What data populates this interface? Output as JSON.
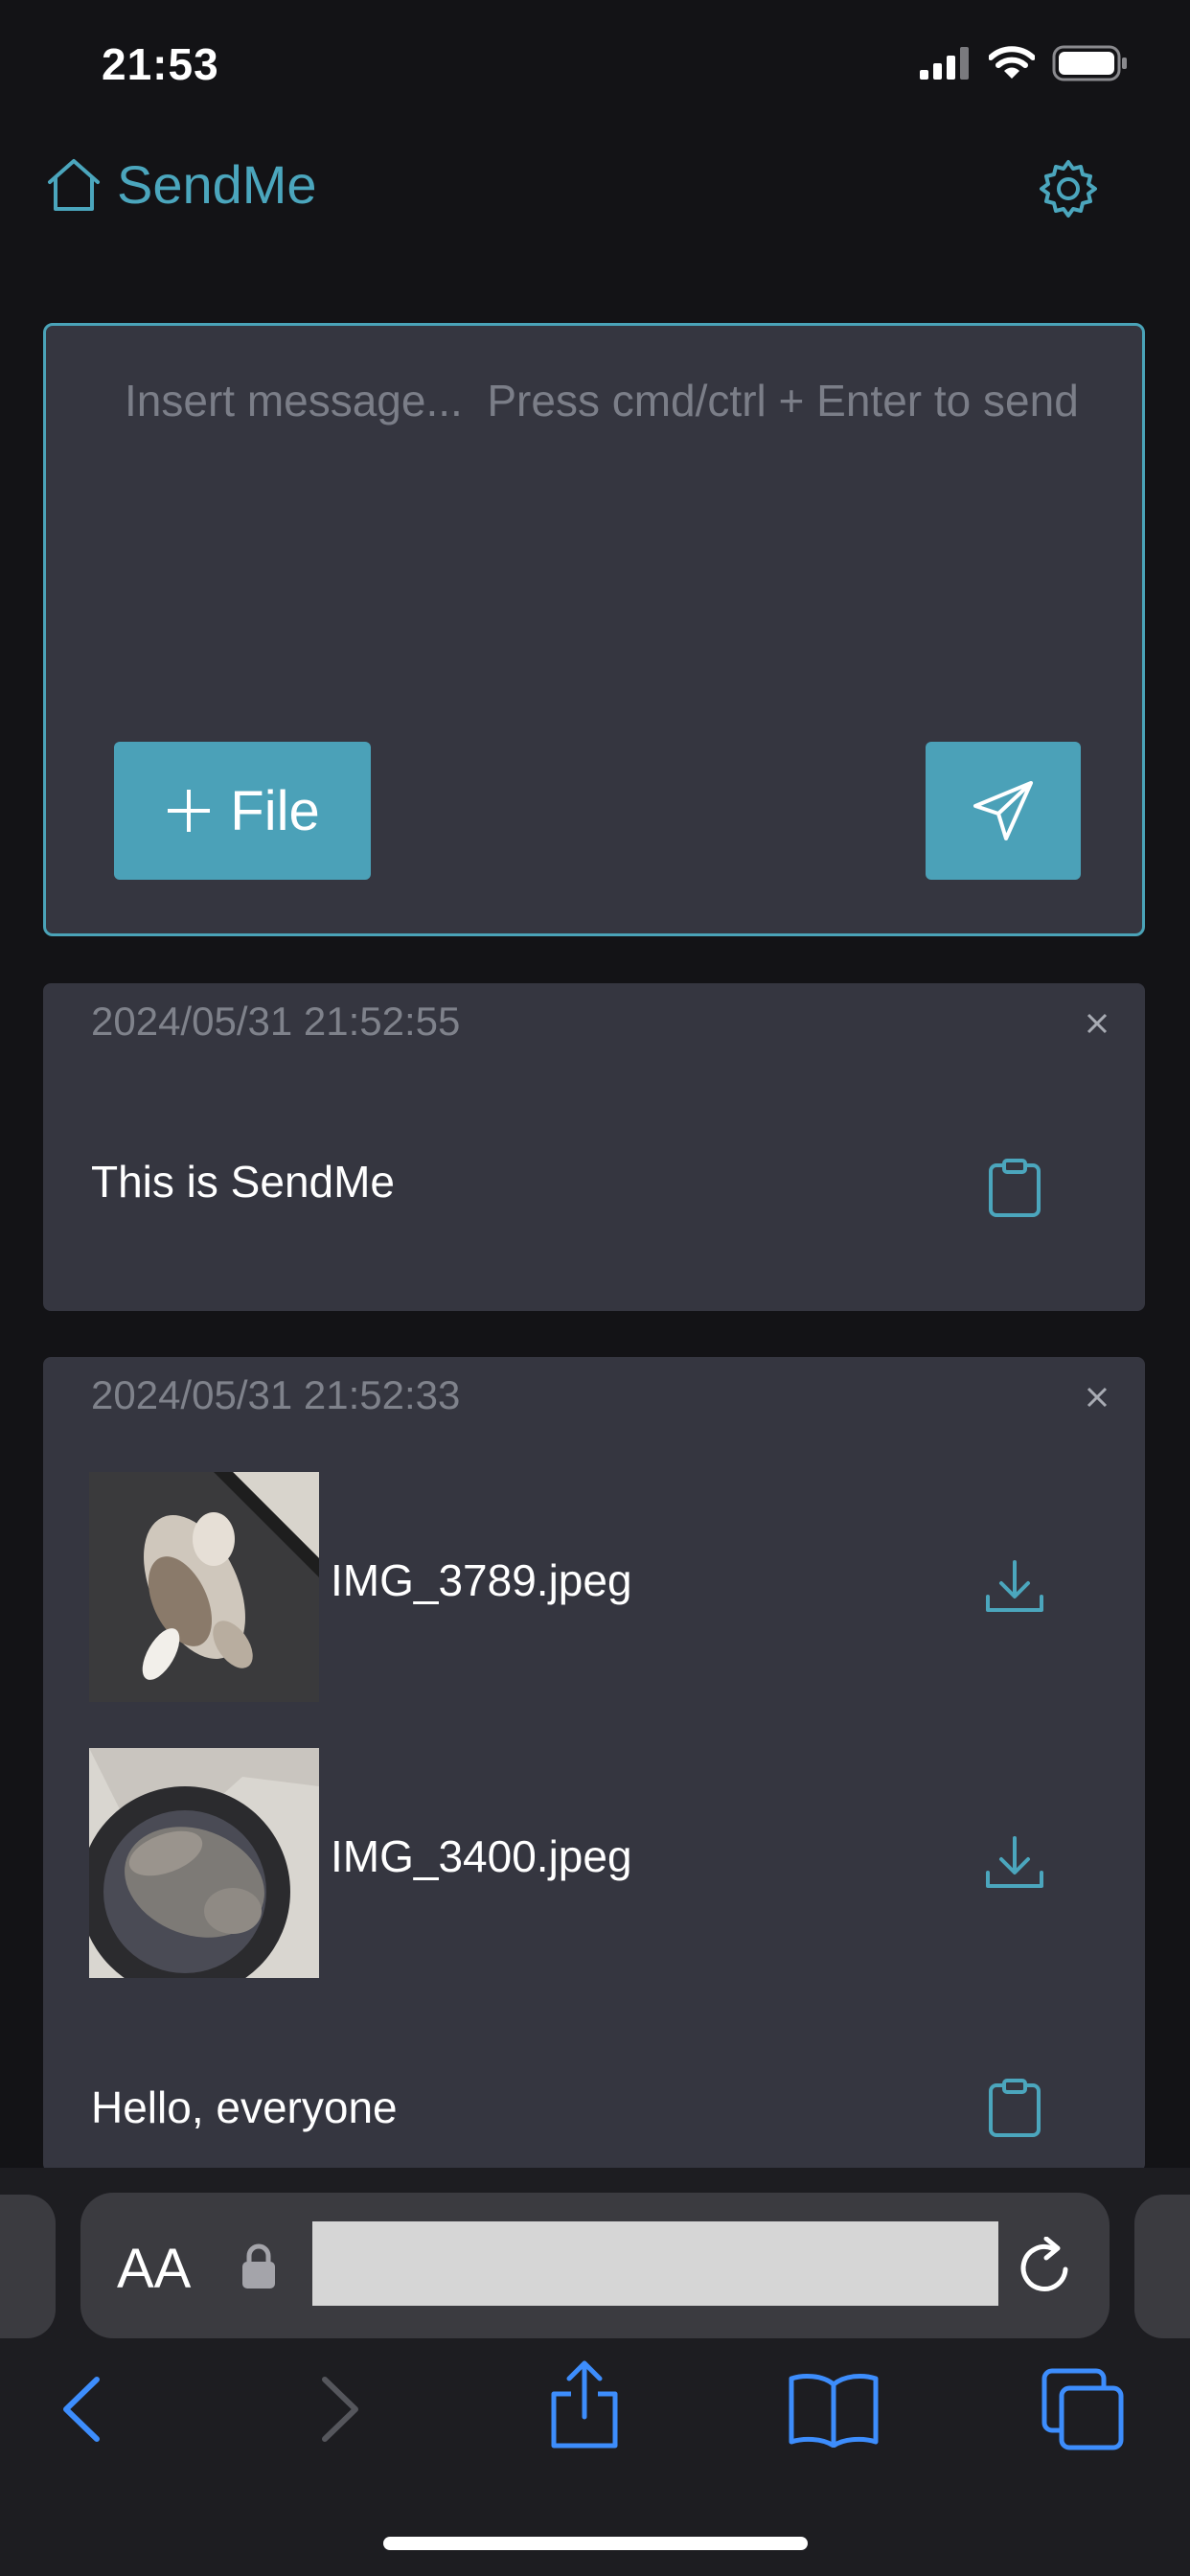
{
  "status_bar": {
    "time": "21:53"
  },
  "header": {
    "title": "SendMe"
  },
  "composer": {
    "placeholder": "Insert message...  Press cmd/ctrl + Enter to send",
    "file_button_label": "File"
  },
  "messages": [
    {
      "timestamp": "2024/05/31 21:52:55",
      "text": "This is SendMe"
    },
    {
      "timestamp": "2024/05/31 21:52:33",
      "files": [
        {
          "name": "IMG_3789.jpeg"
        },
        {
          "name": "IMG_3400.jpeg"
        }
      ],
      "text": "Hello, everyone"
    }
  ],
  "safari": {
    "text_size_label": "AA"
  },
  "colors": {
    "accent": "#4ba6bd",
    "card": "#353640",
    "background": "#131316"
  },
  "icons": [
    "home-icon",
    "gear-icon",
    "plus-icon",
    "send-icon",
    "close-icon",
    "clipboard-icon",
    "download-icon",
    "lock-icon",
    "reload-icon",
    "back-icon",
    "forward-icon",
    "share-icon",
    "bookmarks-icon",
    "tabs-icon"
  ]
}
